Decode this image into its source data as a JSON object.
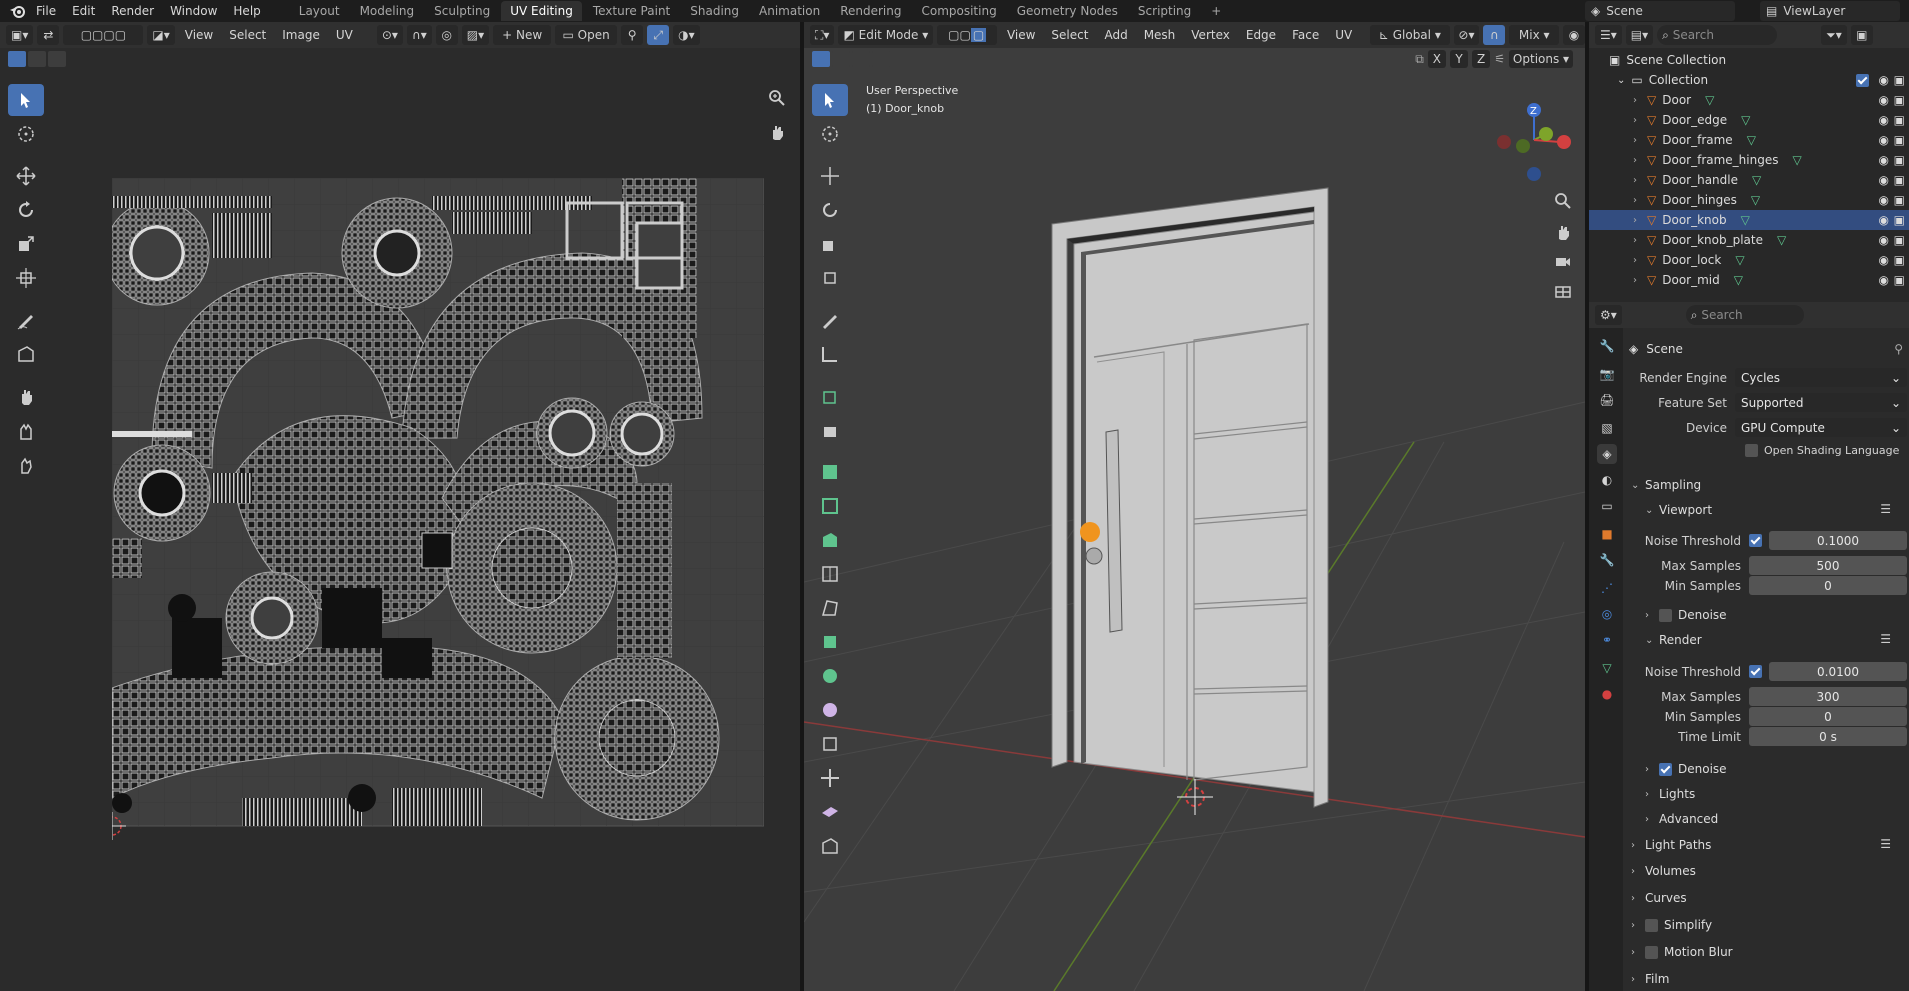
{
  "app": {
    "menus": [
      "File",
      "Edit",
      "Render",
      "Window",
      "Help"
    ],
    "workspaces": [
      "Layout",
      "Modeling",
      "Sculpting",
      "UV Editing",
      "Texture Paint",
      "Shading",
      "Animation",
      "Rendering",
      "Compositing",
      "Geometry Nodes",
      "Scripting"
    ],
    "active_workspace": "UV Editing",
    "add_tab": "+",
    "scene_name": "Scene",
    "view_layer": "ViewLayer"
  },
  "uv_editor": {
    "menus": [
      "View",
      "Select",
      "Image",
      "UV"
    ],
    "new_label": "New",
    "open_label": "Open"
  },
  "viewport": {
    "mode": "Edit Mode",
    "menus": [
      "View",
      "Select",
      "Add",
      "Mesh",
      "Vertex",
      "Edge",
      "Face",
      "UV"
    ],
    "transform_orientation": "Global",
    "overlay_label": "Mix",
    "options_label": "Options",
    "axis_labels": [
      "X",
      "Y",
      "Z"
    ],
    "view_name": "User Perspective",
    "object_info": "(1) Door_knob",
    "gizmo_z": "Z"
  },
  "outliner": {
    "search_placeholder": "Search",
    "collection_root": "Scene Collection",
    "collection": "Collection",
    "objects": [
      "Door",
      "Door_edge",
      "Door_frame",
      "Door_frame_hinges",
      "Door_handle",
      "Door_hinges",
      "Door_knob",
      "Door_knob_plate",
      "Door_lock",
      "Door_mid"
    ],
    "selected": "Door_knob"
  },
  "properties": {
    "search_placeholder": "Search",
    "context": "Scene",
    "render_engine_label": "Render Engine",
    "render_engine": "Cycles",
    "feature_set_label": "Feature Set",
    "feature_set": "Supported",
    "device_label": "Device",
    "device": "GPU Compute",
    "osl_label": "Open Shading Language",
    "sampling": "Sampling",
    "viewport": "Viewport",
    "noise_threshold_label": "Noise Threshold",
    "vp_noise": "0.1000",
    "max_samples_label": "Max Samples",
    "vp_max": "500",
    "min_samples_label": "Min Samples",
    "vp_min": "0",
    "denoise_label": "Denoise",
    "render": "Render",
    "r_noise": "0.0100",
    "r_max": "300",
    "r_min": "0",
    "time_limit_label": "Time Limit",
    "time_limit": "0 s",
    "lights": "Lights",
    "advanced": "Advanced",
    "light_paths": "Light Paths",
    "volumes": "Volumes",
    "curves": "Curves",
    "simplify": "Simplify",
    "motion_blur": "Motion Blur",
    "film": "Film"
  },
  "colors": {
    "accent": "#4772b3",
    "selected_row": "#334d80",
    "object_orange": "#e07a2c",
    "mesh_green": "#5fc48e",
    "origin_red": "#d34040"
  }
}
